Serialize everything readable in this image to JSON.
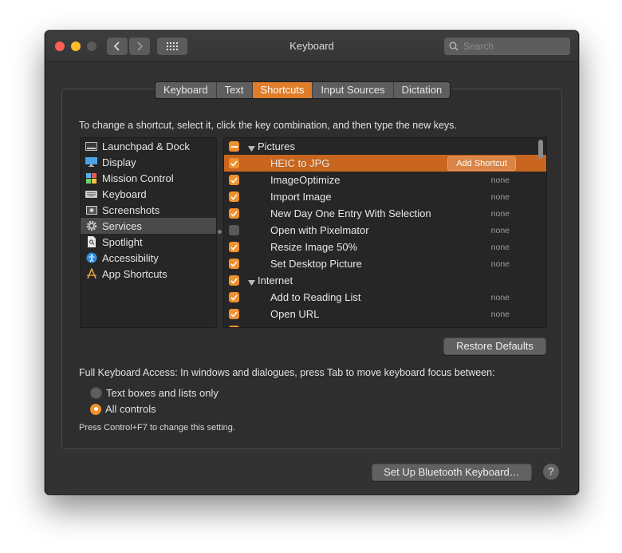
{
  "window": {
    "title": "Keyboard",
    "search_placeholder": "Search"
  },
  "tabs": [
    {
      "label": "Keyboard",
      "active": false
    },
    {
      "label": "Text",
      "active": false
    },
    {
      "label": "Shortcuts",
      "active": true
    },
    {
      "label": "Input Sources",
      "active": false
    },
    {
      "label": "Dictation",
      "active": false
    }
  ],
  "instructions": "To change a shortcut, select it, click the key combination, and then type the new keys.",
  "categories": [
    {
      "label": "Launchpad & Dock",
      "icon": "launchpad-icon"
    },
    {
      "label": "Display",
      "icon": "display-icon"
    },
    {
      "label": "Mission Control",
      "icon": "mission-control-icon"
    },
    {
      "label": "Keyboard",
      "icon": "keyboard-icon"
    },
    {
      "label": "Screenshots",
      "icon": "screenshots-icon"
    },
    {
      "label": "Services",
      "icon": "gear-icon",
      "selected": true
    },
    {
      "label": "Spotlight",
      "icon": "spotlight-icon"
    },
    {
      "label": "Accessibility",
      "icon": "accessibility-icon"
    },
    {
      "label": "App Shortcuts",
      "icon": "app-shortcuts-icon"
    }
  ],
  "shortcuts": {
    "pictures_group": "Pictures",
    "internet_group": "Internet",
    "add_shortcut_label": "Add Shortcut",
    "items": [
      {
        "label": "HEIC to JPG",
        "key": "",
        "checked": true,
        "selected": true
      },
      {
        "label": "ImageOptimize",
        "key": "none",
        "checked": true
      },
      {
        "label": "Import Image",
        "key": "none",
        "checked": true
      },
      {
        "label": "New Day One Entry With Selection",
        "key": "none",
        "checked": true
      },
      {
        "label": "Open with Pixelmator",
        "key": "none",
        "checked": false
      },
      {
        "label": "Resize Image 50%",
        "key": "none",
        "checked": true
      },
      {
        "label": "Set Desktop Picture",
        "key": "none",
        "checked": true
      }
    ],
    "internet_items": [
      {
        "label": "Add to Reading List",
        "key": "none",
        "checked": true
      },
      {
        "label": "Open URL",
        "key": "none",
        "checked": true
      }
    ]
  },
  "restore_defaults_label": "Restore Defaults",
  "full_keyboard_access": {
    "text": "Full Keyboard Access: In windows and dialogues, press Tab to move keyboard focus between:",
    "options": [
      {
        "label": "Text boxes and lists only",
        "selected": false
      },
      {
        "label": "All controls",
        "selected": true
      }
    ],
    "hint": "Press Control+F7 to change this setting."
  },
  "bluetooth_button_label": "Set Up Bluetooth Keyboard…",
  "help_label": "?",
  "colors": {
    "accent": "#e07d2a",
    "selection": "#c8651e",
    "background": "#323232"
  }
}
